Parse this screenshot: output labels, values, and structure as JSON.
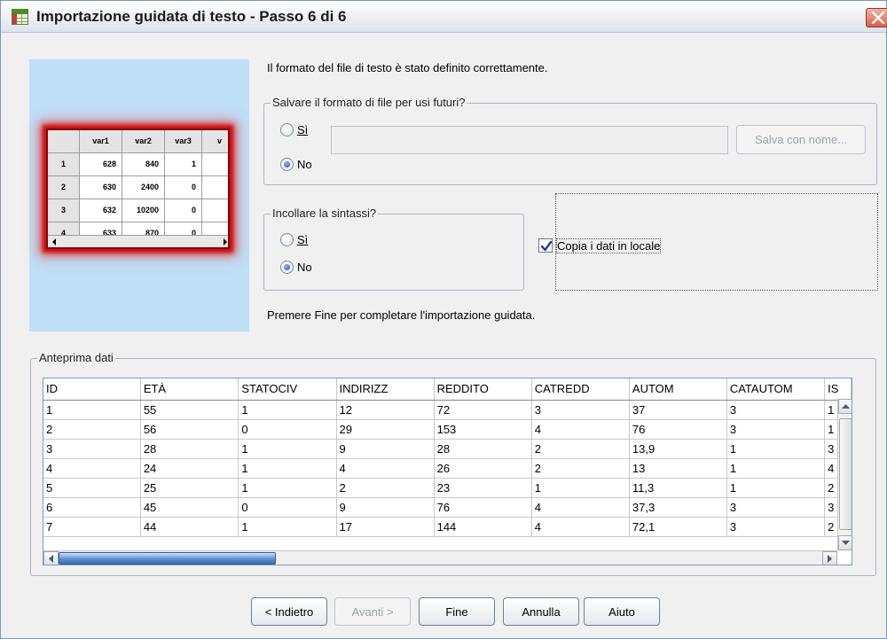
{
  "window": {
    "title": "Importazione guidata di testo - Passo 6 di 6"
  },
  "illustration": {
    "headers": [
      "",
      "var1",
      "var2",
      "var3",
      "v"
    ],
    "rows": [
      [
        "1",
        "628",
        "840",
        "1"
      ],
      [
        "2",
        "630",
        "2400",
        "0"
      ],
      [
        "3",
        "632",
        "10200",
        "0"
      ],
      [
        "4",
        "633",
        "870",
        "0"
      ]
    ]
  },
  "main": {
    "intro": "Il formato del file di testo è stato definito correttamente.",
    "save_format": {
      "legend": "Salvare il formato di file per usi futuri?",
      "yes_label": "Sì",
      "no_label": "No",
      "selected": "No",
      "file_path": "",
      "save_as_button": "Salva con nome..."
    },
    "paste_syntax": {
      "legend": "Incollare la sintassi?",
      "yes_label": "Sì",
      "no_label": "No",
      "selected": "No"
    },
    "cache_data": {
      "label": "Copia i dati in locale",
      "checked": true
    },
    "finish_msg": "Premere Fine per completare l'importazione guidata."
  },
  "preview": {
    "legend": "Anteprima dati",
    "columns": [
      "ID",
      "ETÀ",
      "STATOCIV",
      "INDIRIZZ",
      "REDDITO",
      "CATREDD",
      "AUTOM",
      "CATAUTOM",
      "IS"
    ],
    "rows": [
      [
        "1",
        "55",
        "1",
        "12",
        "72",
        "3",
        "37",
        "3",
        "1"
      ],
      [
        "2",
        "56",
        "0",
        "29",
        "153",
        "4",
        "76",
        "3",
        "1"
      ],
      [
        "3",
        "28",
        "1",
        "9",
        "28",
        "2",
        "13,9",
        "1",
        "3"
      ],
      [
        "4",
        "24",
        "1",
        "4",
        "26",
        "2",
        "13",
        "1",
        "4"
      ],
      [
        "5",
        "25",
        "1",
        "2",
        "23",
        "1",
        "11,3",
        "1",
        "2"
      ],
      [
        "6",
        "45",
        "0",
        "9",
        "76",
        "4",
        "37,3",
        "3",
        "3"
      ],
      [
        "7",
        "44",
        "1",
        "17",
        "144",
        "4",
        "72,1",
        "3",
        "2"
      ]
    ]
  },
  "footer": {
    "back": "< Indietro",
    "next": "Avanti >",
    "finish": "Fine",
    "cancel": "Annulla",
    "help": "Aiuto"
  },
  "colors": {
    "window_bg": "#f0f0f0",
    "illustration_bg": "#bfe0f7",
    "glow_red": "#c91010",
    "accent_blue": "#3a6fb5"
  }
}
